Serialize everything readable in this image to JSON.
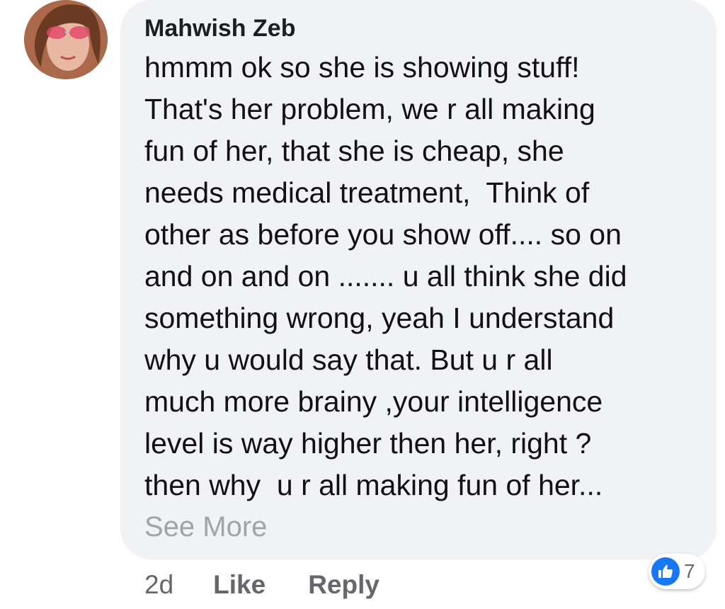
{
  "comment": {
    "author": "Mahwish Zeb",
    "body_lines": [
      "hmmm ok so she is showing stuff!",
      "That's her problem, we r all making",
      "fun of her, that she is cheap, she",
      "needs medical treatment,  Think of",
      "other as before you show off.... so on",
      "and on and on ....... u all think she did",
      "something wrong, yeah I understand",
      "why u would say that. But u r all",
      "much more brainy ,your intelligence",
      "level is way higher then her, right ?",
      "then why  u r all making fun of her..."
    ],
    "see_more": "See More",
    "timestamp": "2d",
    "like_label": "Like",
    "reply_label": "Reply",
    "reaction_count": "7",
    "reaction_icon": "thumbs-up-icon"
  },
  "colors": {
    "bubble": "#f0f2f5",
    "reaction_blue": "#1877f2",
    "meta_gray": "#65676b",
    "see_more_gray": "#a0a3a8"
  }
}
